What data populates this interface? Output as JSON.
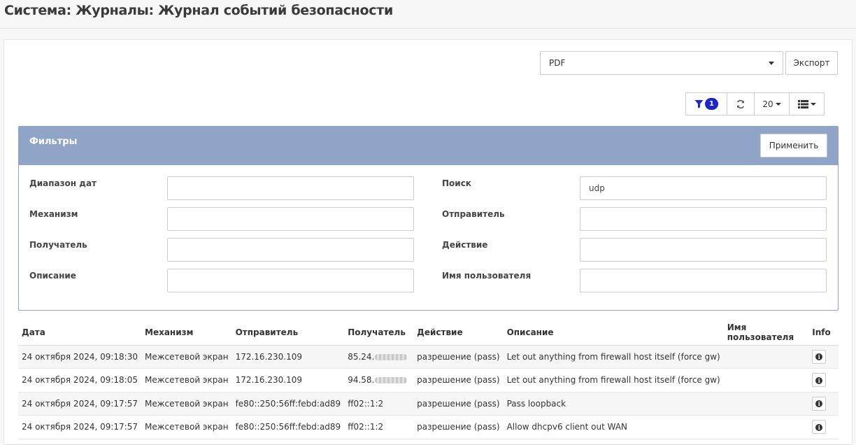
{
  "page": {
    "title": "Система: Журналы: Журнал событий безопасности"
  },
  "export": {
    "format_value": "PDF",
    "button_label": "Экспорт"
  },
  "toolbar": {
    "filter_count": "1",
    "page_size": "20"
  },
  "filters": {
    "title": "Фильтры",
    "apply_label": "Применить",
    "fields": [
      {
        "label": "Диапазон дат",
        "value": ""
      },
      {
        "label": "Поиск",
        "value": "udp"
      },
      {
        "label": "Механизм",
        "value": ""
      },
      {
        "label": "Отправитель",
        "value": ""
      },
      {
        "label": "Получатель",
        "value": ""
      },
      {
        "label": "Действие",
        "value": ""
      },
      {
        "label": "Описание",
        "value": ""
      },
      {
        "label": "Имя пользователя",
        "value": ""
      }
    ]
  },
  "table": {
    "headers": [
      "Дата",
      "Механизм",
      "Отправитель",
      "Получатель",
      "Действие",
      "Описание",
      "Имя пользователя",
      "Info"
    ],
    "rows": [
      {
        "date": "24 октября 2024, 09:18:30",
        "mechanism": "Межсетевой экран",
        "sender": "172.16.230.109",
        "receiver": "85.24.",
        "action": "разрешение (pass)",
        "description": "Let out anything from firewall host itself (force gw)",
        "user": ""
      },
      {
        "date": "24 октября 2024, 09:18:05",
        "mechanism": "Межсетевой экран",
        "sender": "172.16.230.109",
        "receiver": "94.58.",
        "action": "разрешение (pass)",
        "description": "Let out anything from firewall host itself (force gw)",
        "user": ""
      },
      {
        "date": "24 октября 2024, 09:17:57",
        "mechanism": "Межсетевой экран",
        "sender": "fe80::250:56ff:febd:ad89",
        "receiver": "ff02::1:2",
        "action": "разрешение (pass)",
        "description": "Pass loopback",
        "user": ""
      },
      {
        "date": "24 октября 2024, 09:17:57",
        "mechanism": "Межсетевой экран",
        "sender": "fe80::250:56ff:febd:ad89",
        "receiver": "ff02::1:2",
        "action": "разрешение (pass)",
        "description": "Allow dhcpv6 client out WAN",
        "user": ""
      }
    ]
  }
}
